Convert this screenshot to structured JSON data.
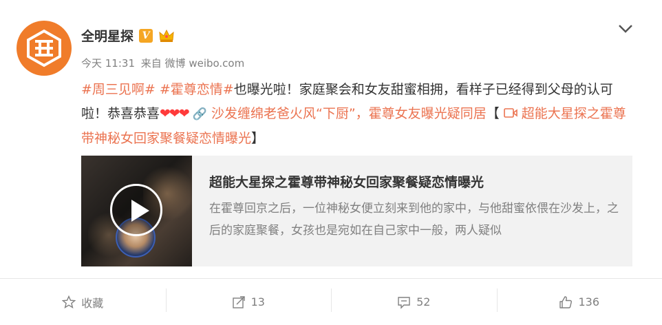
{
  "post": {
    "author": "全明星探",
    "verified_badge": "V",
    "meta_time": "今天 11:31",
    "meta_source": "来自 微博 weibo.com",
    "tag1": "#周三见啊#",
    "tag2": "#霍尊恋情#",
    "text1": "也曝光啦！家庭聚会和女友甜蜜相拥，看样子已经得到父母的认可啦！恭喜恭喜",
    "hearts": "❤❤❤",
    "link_text": "沙发缠绵老爸火风“下厨”，霍尊女友曝光疑同居",
    "bracket_open": "【",
    "video_link": "超能大星探之霍尊带神秘女回家聚餐疑恋情曝光",
    "bracket_close": "】"
  },
  "media_card": {
    "title": "超能大星探之霍尊带神秘女回家聚餐疑恋情曝光",
    "description": "在霍尊回京之后，一位神秘女便立刻来到他的家中，与他甜蜜依偎在沙发上，之后的家庭聚餐，女孩也是宛如在自己家中一般，两人疑似"
  },
  "actions": {
    "favorite": "收藏",
    "repost_count": "13",
    "comment_count": "52",
    "like_count": "136"
  },
  "colors": {
    "brand_orange": "#f07c2a",
    "link": "#eb7350",
    "muted": "#808080"
  },
  "icons": [
    "logo-icon",
    "verified-icon",
    "crown-icon",
    "chevron-down-icon",
    "link-icon",
    "video-icon",
    "play-icon",
    "star-icon",
    "repost-icon",
    "comment-icon",
    "like-icon"
  ]
}
